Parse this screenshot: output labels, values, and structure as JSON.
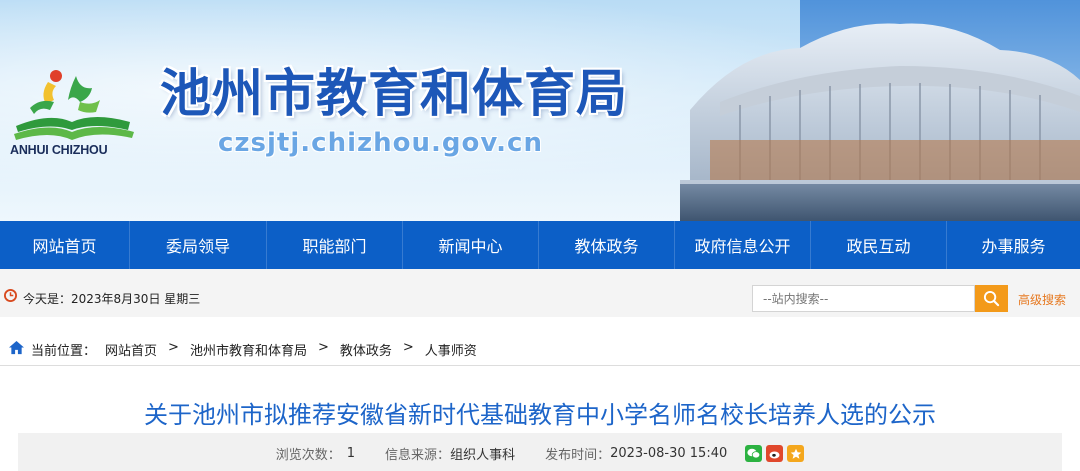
{
  "header": {
    "logo_text": "ANHUI CHIZHOU",
    "site_title": "池州市教育和体育局",
    "site_domain": "czsjtj.chizhou.gov.cn"
  },
  "nav": {
    "items": [
      {
        "label": "网站首页"
      },
      {
        "label": "委局领导"
      },
      {
        "label": "职能部门"
      },
      {
        "label": "新闻中心"
      },
      {
        "label": "教体政务"
      },
      {
        "label": "政府信息公开"
      },
      {
        "label": "政民互动"
      },
      {
        "label": "办事服务"
      }
    ]
  },
  "infobar": {
    "date_text": "今天是：2023年8月30日 星期三",
    "search_placeholder": "--站内搜索--",
    "advanced_search": "高级搜索"
  },
  "breadcrumb": {
    "prefix": "当前位置：",
    "items": [
      "网站首页",
      "池州市教育和体育局",
      "教体政务",
      "人事师资"
    ],
    "separator": ">"
  },
  "article": {
    "title": "关于池州市拟推荐安徽省新时代基础教育中小学名师名校长培养人选的公示",
    "views_label": "浏览次数：",
    "views_value": "1",
    "source_label": "信息来源：",
    "source_value": "组织人事科",
    "date_label": "发布时间：",
    "date_value": "2023-08-30 15:40"
  },
  "share": {
    "icons": [
      "wechat-icon",
      "weibo-icon",
      "qzone-icon"
    ]
  },
  "colors": {
    "nav_bg": "#0c5fc7",
    "title_blue": "#1d65c9",
    "search_orange": "#f39a1a"
  }
}
